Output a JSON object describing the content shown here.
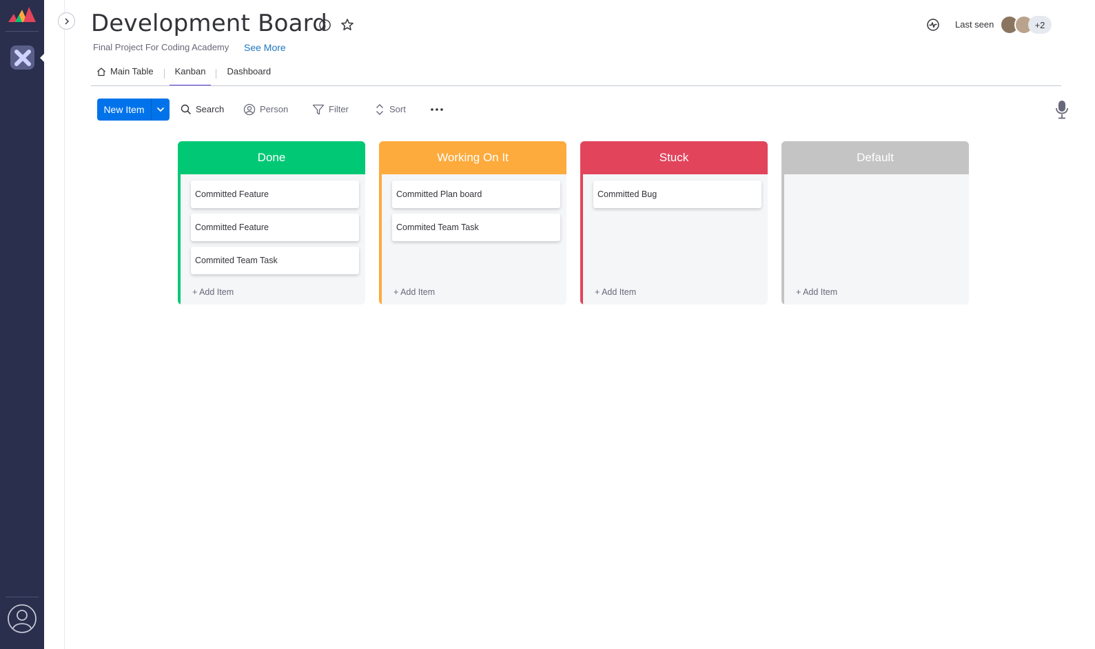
{
  "board": {
    "title": "Development Board",
    "description": "Final Project For Coding Academy",
    "see_more": "See More"
  },
  "header": {
    "last_seen_label": "Last seen",
    "extra_viewers": "+2"
  },
  "tabs": [
    {
      "label": "Main Table",
      "icon": "home-icon",
      "active": false
    },
    {
      "label": "Kanban",
      "active": true
    },
    {
      "label": "Dashboard",
      "active": false
    }
  ],
  "toolbar": {
    "new_item": "New Item",
    "search": "Search",
    "person": "Person",
    "filter": "Filter",
    "sort": "Sort"
  },
  "columns": [
    {
      "title": "Done",
      "color": "#00c875",
      "cards": [
        "Committed Feature",
        "Committed Feature",
        "Commited Team Task"
      ],
      "add_label": "+ Add Item"
    },
    {
      "title": "Working On It",
      "color": "#fdab3d",
      "cards": [
        "Committed Plan board",
        "Commited Team Task"
      ],
      "add_label": "+ Add Item"
    },
    {
      "title": "Stuck",
      "color": "#e2445c",
      "cards": [
        "Committed Bug"
      ],
      "add_label": "+ Add Item"
    },
    {
      "title": "Default",
      "color": "#c4c4c4",
      "cards": [],
      "add_label": "+ Add Item"
    }
  ],
  "colors": {
    "sidebar": "#292f4c",
    "primary": "#0073ea",
    "tab_active": "#5f45d6"
  }
}
